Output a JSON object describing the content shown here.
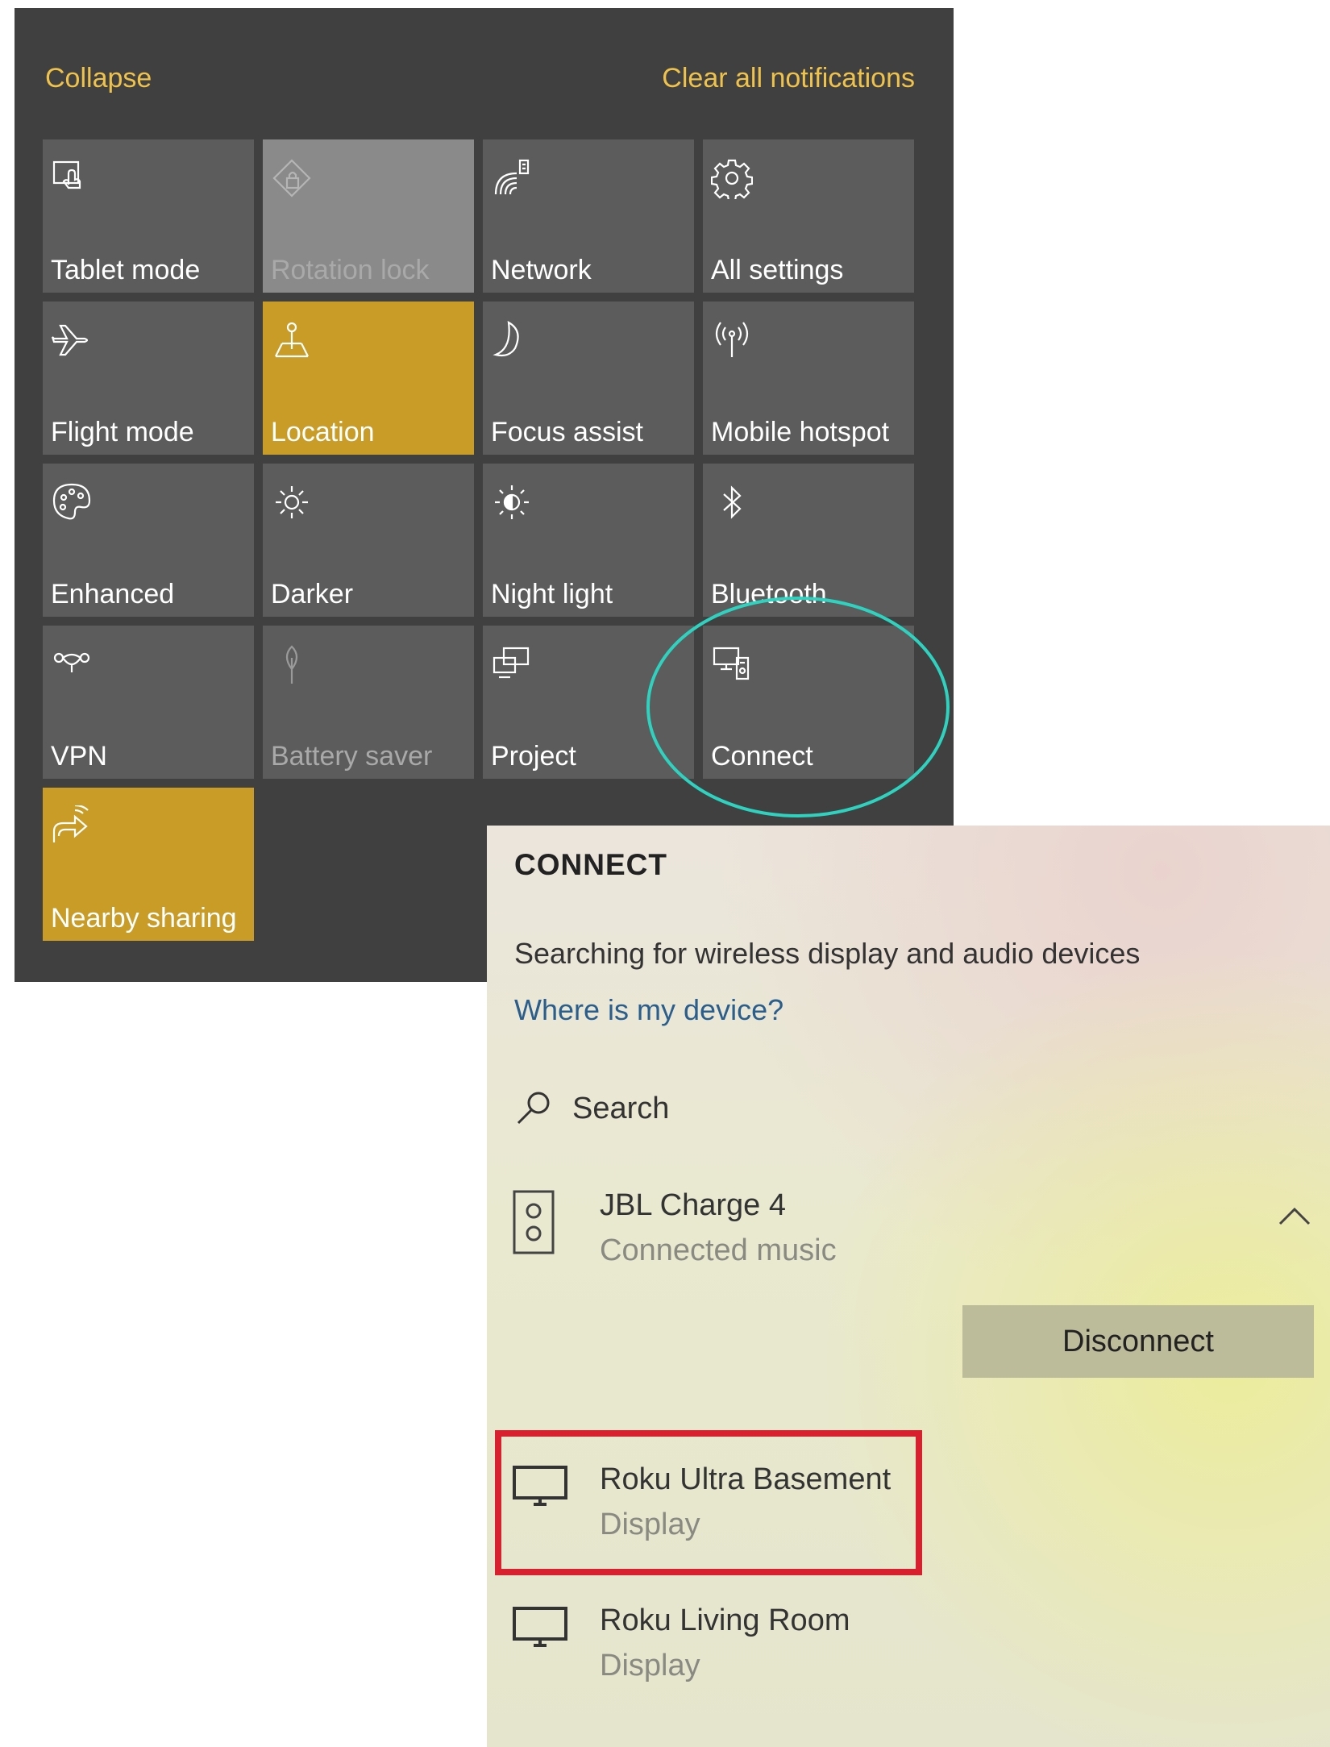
{
  "action_center": {
    "collapse": "Collapse",
    "clear_all": "Clear all notifications",
    "tiles": [
      {
        "label": "Tablet mode",
        "icon": "tablet-mode-icon",
        "state": "off"
      },
      {
        "label": "Rotation lock",
        "icon": "rotation-lock-icon",
        "state": "disabled"
      },
      {
        "label": "Network",
        "icon": "network-icon",
        "state": "off"
      },
      {
        "label": "All settings",
        "icon": "gear-icon",
        "state": "off"
      },
      {
        "label": "Flight mode",
        "icon": "airplane-icon",
        "state": "off"
      },
      {
        "label": "Location",
        "icon": "location-icon",
        "state": "on"
      },
      {
        "label": "Focus assist",
        "icon": "moon-icon",
        "state": "off"
      },
      {
        "label": "Mobile hotspot",
        "icon": "hotspot-icon",
        "state": "off"
      },
      {
        "label": "Enhanced",
        "icon": "palette-icon",
        "state": "off"
      },
      {
        "label": "Darker",
        "icon": "brightness-icon",
        "state": "off"
      },
      {
        "label": "Night light",
        "icon": "night-light-icon",
        "state": "off"
      },
      {
        "label": "Bluetooth",
        "icon": "bluetooth-icon",
        "state": "off"
      },
      {
        "label": "VPN",
        "icon": "vpn-icon",
        "state": "off"
      },
      {
        "label": "Battery saver",
        "icon": "battery-saver-icon",
        "state": "unavailable"
      },
      {
        "label": "Project",
        "icon": "project-icon",
        "state": "off"
      },
      {
        "label": "Connect",
        "icon": "connect-icon",
        "state": "off"
      },
      {
        "label": "Nearby sharing",
        "icon": "nearby-sharing-icon",
        "state": "on"
      }
    ]
  },
  "connect_panel": {
    "title": "CONNECT",
    "status": "Searching for wireless display and audio devices",
    "help_link": "Where is my device?",
    "search_label": "Search",
    "devices": [
      {
        "name": "JBL Charge 4",
        "subtitle": "Connected music",
        "icon": "speaker-icon",
        "expanded": true,
        "action": "Disconnect"
      },
      {
        "name": "Roku Ultra Basement",
        "subtitle": "Display",
        "icon": "monitor-icon",
        "highlighted": true
      },
      {
        "name": "Roku Living Room",
        "subtitle": "Display",
        "icon": "monitor-icon"
      }
    ]
  },
  "colors": {
    "accent": "#c99c28",
    "link_yellow": "#efc24a",
    "tile_bg": "#5c5c5c",
    "panel_bg": "#404040",
    "highlight_ellipse": "#2ed3c0",
    "highlight_box": "#d8202e",
    "help_link": "#2a5e8c"
  }
}
